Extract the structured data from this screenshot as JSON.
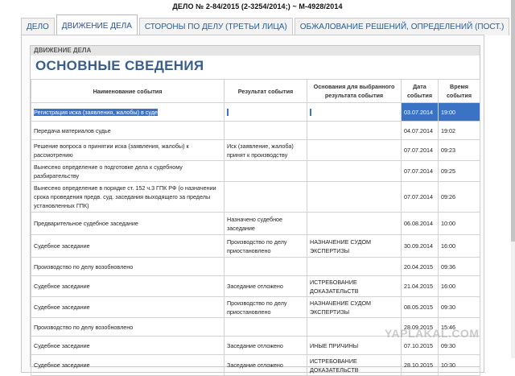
{
  "case_title": "ДЕЛО № 2-84/2015 (2-3254/2014;) ~ М-4928/2014",
  "tabs": [
    {
      "label": "ДЕЛО",
      "active": false
    },
    {
      "label": "ДВИЖЕНИЕ ДЕЛА",
      "active": true
    },
    {
      "label": "СТОРОНЫ ПО ДЕЛУ (ТРЕТЬИ ЛИЦА)",
      "active": false
    },
    {
      "label": "ОБЖАЛОВАНИЕ РЕШЕНИЙ, ОПРЕДЕЛЕНИЙ (ПОСТ.)",
      "active": false
    }
  ],
  "section_label": "ДВИЖЕНИЕ ДЕЛА",
  "section_title": "ОСНОВНЫЕ СВЕДЕНИЯ",
  "table": {
    "headers": [
      "Наименование события",
      "Результат события",
      "Основания для выбранного результата события",
      "Дата события",
      "Время события"
    ],
    "rows": [
      {
        "event": "Регистрация иска (заявления, жалобы) в суде",
        "result": "",
        "basis": "",
        "date": "03.07.2014",
        "time": "19:00"
      },
      {
        "event": "Передача материалов судье",
        "result": "",
        "basis": "",
        "date": "04.07.2014",
        "time": "19:02"
      },
      {
        "event": "Решение вопроса о принятии иска (заявления, жалобы) к рассмотрению",
        "result": "Иск (заявление, жалоба) принят к производству",
        "basis": "",
        "date": "07.07.2014",
        "time": "09:23"
      },
      {
        "event": "Вынесено определение о подготовке дела к судебному разбирательству",
        "result": "",
        "basis": "",
        "date": "07.07.2014",
        "time": "09:25"
      },
      {
        "event": "Вынесено определение в порядке ст. 152 ч.3 ГПК РФ (о назначении срока проведения предв. суд. заседания выходящего за пределы установленных ГПК)",
        "result": "",
        "basis": "",
        "date": "07.07.2014",
        "time": "09:26"
      },
      {
        "event": "Предварительное судебное заседание",
        "result": "Назначено судебное заседание",
        "basis": "",
        "date": "06.08.2014",
        "time": "10:00"
      },
      {
        "event": "Судебное заседание",
        "result": "Производство по делу приостановлено",
        "basis": "НАЗНАЧЕНИЕ СУДОМ ЭКСПЕРТИЗЫ",
        "date": "30.09.2014",
        "time": "16:00"
      },
      {
        "event": "Производство по делу возобновлено",
        "result": "",
        "basis": "",
        "date": "20.04.2015",
        "time": "09:36"
      },
      {
        "event": "Судебное заседание",
        "result": "Заседание отложено",
        "basis": "ИСТРЕБОВАНИЕ ДОКАЗАТЕЛЬСТВ",
        "date": "21.04.2015",
        "time": "16:00"
      },
      {
        "event": "Судебное заседание",
        "result": "Производство по делу приостановлено",
        "basis": "НАЗНАЧЕНИЕ СУДОМ ЭКСПЕРТИЗЫ",
        "date": "08.05.2015",
        "time": "09:30"
      },
      {
        "event": "Производство по делу возобновлено",
        "result": "",
        "basis": "",
        "date": "28.09.2015",
        "time": "15:46"
      },
      {
        "event": "Судебное заседание",
        "result": "Заседание отложено",
        "basis": "ИНЫЕ ПРИЧИНЫ",
        "date": "07.10.2015",
        "time": "09:30"
      },
      {
        "event": "Судебное заседание",
        "result": "Заседание отложено",
        "basis": "ИСТРЕБОВАНИЕ ДОКАЗАТЕЛЬСТВ",
        "date": "28.10.2015",
        "time": "10:30"
      }
    ]
  },
  "watermark": "YAPLAKAL.COM",
  "colors": {
    "accent": "#3a5e8b",
    "tab_text": "#1f5fa0",
    "selection": "#3a72c4"
  }
}
